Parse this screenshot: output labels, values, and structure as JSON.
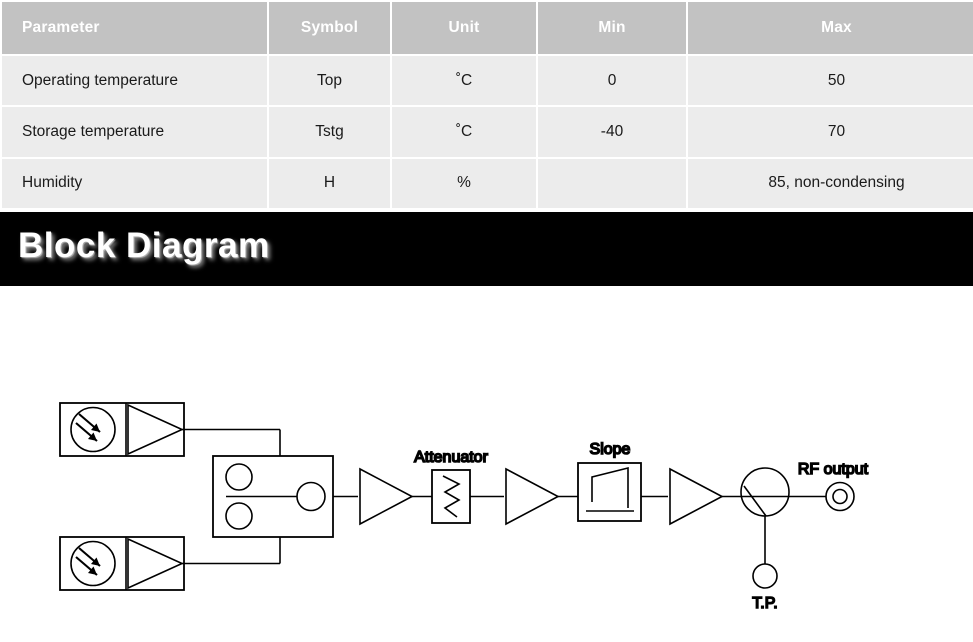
{
  "table": {
    "headers": [
      "Parameter",
      "Symbol",
      "Unit",
      "Min",
      "Max"
    ],
    "rows": [
      {
        "parameter": "Operating temperature",
        "symbol": "Top",
        "unit": "˚C",
        "min": "0",
        "max": "50"
      },
      {
        "parameter": "Storage temperature",
        "symbol": "Tstg",
        "unit": "˚C",
        "min": "-40",
        "max": "70"
      },
      {
        "parameter": "Humidity",
        "symbol": "H",
        "unit": "%",
        "min": "",
        "max": "85, non-condensing"
      }
    ],
    "header_bg": "#c2c2c2",
    "header_text_color": "#ffffff",
    "cell_bg": "#ececec",
    "cell_text_color": "#1a1a1a"
  },
  "banner": {
    "title": "Block Diagram",
    "bg": "#000000",
    "text_color": "#ffffff"
  },
  "diagram": {
    "labels": {
      "attenuator": "Attenuator",
      "slope": "Slope",
      "rf_output": "RF output",
      "test_point": "T.P."
    },
    "line_color": "#000000",
    "background": "#ffffff"
  }
}
